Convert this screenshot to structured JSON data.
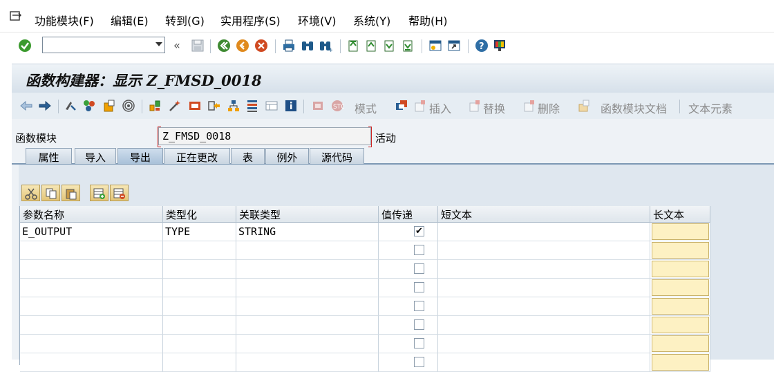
{
  "menu": {
    "items": [
      {
        "label": "功能模块(F)"
      },
      {
        "label": "编辑(E)"
      },
      {
        "label": "转到(G)"
      },
      {
        "label": "实用程序(S)"
      },
      {
        "label": "环境(V)"
      },
      {
        "label": "系统(Y)"
      },
      {
        "label": "帮助(H)"
      }
    ]
  },
  "std_toolbar": {
    "command_value": "",
    "back_chevron": "«"
  },
  "title": "函数构建器：显示 Z_FMSD_0018",
  "app_toolbar": {
    "mode_label": "模式",
    "insert_label": "插入",
    "replace_label": "替换",
    "delete_label": "删除",
    "fm_doc_label": "函数模块文档",
    "text_elements_label": "文本元素"
  },
  "function_module": {
    "label": "函数模块",
    "value": "Z_FMSD_0018",
    "status": "活动"
  },
  "tabs": [
    {
      "label": "属性",
      "active": false
    },
    {
      "label": "导入",
      "active": false
    },
    {
      "label": "导出",
      "active": true
    },
    {
      "label": "正在更改",
      "active": false
    },
    {
      "label": "表",
      "active": false
    },
    {
      "label": "例外",
      "active": false
    },
    {
      "label": "源代码",
      "active": false
    }
  ],
  "table": {
    "columns": [
      "参数名称",
      "类型化",
      "关联类型",
      "值传递",
      "短文本",
      "长文本"
    ],
    "rows": [
      {
        "param": "E_OUTPUT",
        "typing": "TYPE",
        "assoc_type": "STRING",
        "pass_by_value": true,
        "short_text": ""
      },
      {
        "param": "",
        "typing": "",
        "assoc_type": "",
        "pass_by_value": false,
        "short_text": ""
      },
      {
        "param": "",
        "typing": "",
        "assoc_type": "",
        "pass_by_value": false,
        "short_text": ""
      },
      {
        "param": "",
        "typing": "",
        "assoc_type": "",
        "pass_by_value": false,
        "short_text": ""
      },
      {
        "param": "",
        "typing": "",
        "assoc_type": "",
        "pass_by_value": false,
        "short_text": ""
      },
      {
        "param": "",
        "typing": "",
        "assoc_type": "",
        "pass_by_value": false,
        "short_text": ""
      },
      {
        "param": "",
        "typing": "",
        "assoc_type": "",
        "pass_by_value": false,
        "short_text": ""
      },
      {
        "param": "",
        "typing": "",
        "assoc_type": "",
        "pass_by_value": false,
        "short_text": ""
      }
    ]
  },
  "colors": {
    "title_bar": "#d6e0ea",
    "panel": "#dfe7ef",
    "long_text_button": "#fdf1c3",
    "active_tab": "#a9c1d9"
  }
}
